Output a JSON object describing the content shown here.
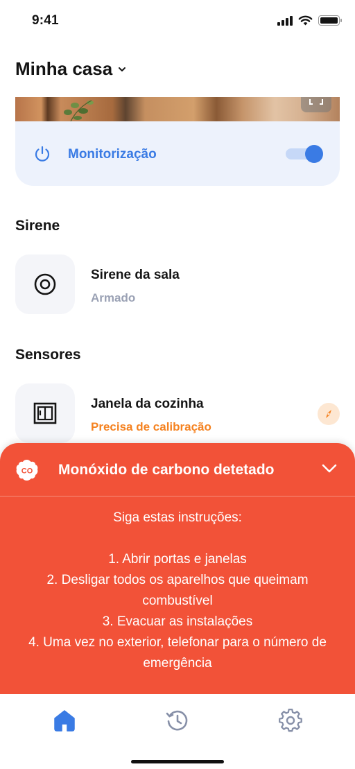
{
  "status_bar": {
    "time": "9:41"
  },
  "header": {
    "home_name": "Minha casa"
  },
  "monitoring": {
    "label": "Monitorização",
    "enabled": true
  },
  "sections": {
    "siren": {
      "title": "Sirene",
      "device": {
        "name": "Sirene da sala",
        "status": "Armado"
      }
    },
    "sensors": {
      "title": "Sensores",
      "device": {
        "name": "Janela da cozinha",
        "status": "Precisa de calibração"
      }
    }
  },
  "alert": {
    "badge": "CO",
    "title": "Monóxido de carbono detetado",
    "intro": "Siga estas instruções:",
    "steps": [
      "1. Abrir portas e janelas",
      "2. Desligar todos os aparelhos que queimam combustível",
      "3. Evacuar as instalações",
      "4. Uma vez no exterior, telefonar para o número de emergência"
    ]
  },
  "tabs": [
    {
      "icon": "home-icon",
      "active": true
    },
    {
      "icon": "history-icon",
      "active": false
    },
    {
      "icon": "gear-icon",
      "active": false
    }
  ],
  "colors": {
    "accent": "#3a7be4",
    "alert": "#f25238",
    "warning": "#f58220",
    "muted": "#9aa1b4",
    "inactive_tab": "#8790a8"
  }
}
